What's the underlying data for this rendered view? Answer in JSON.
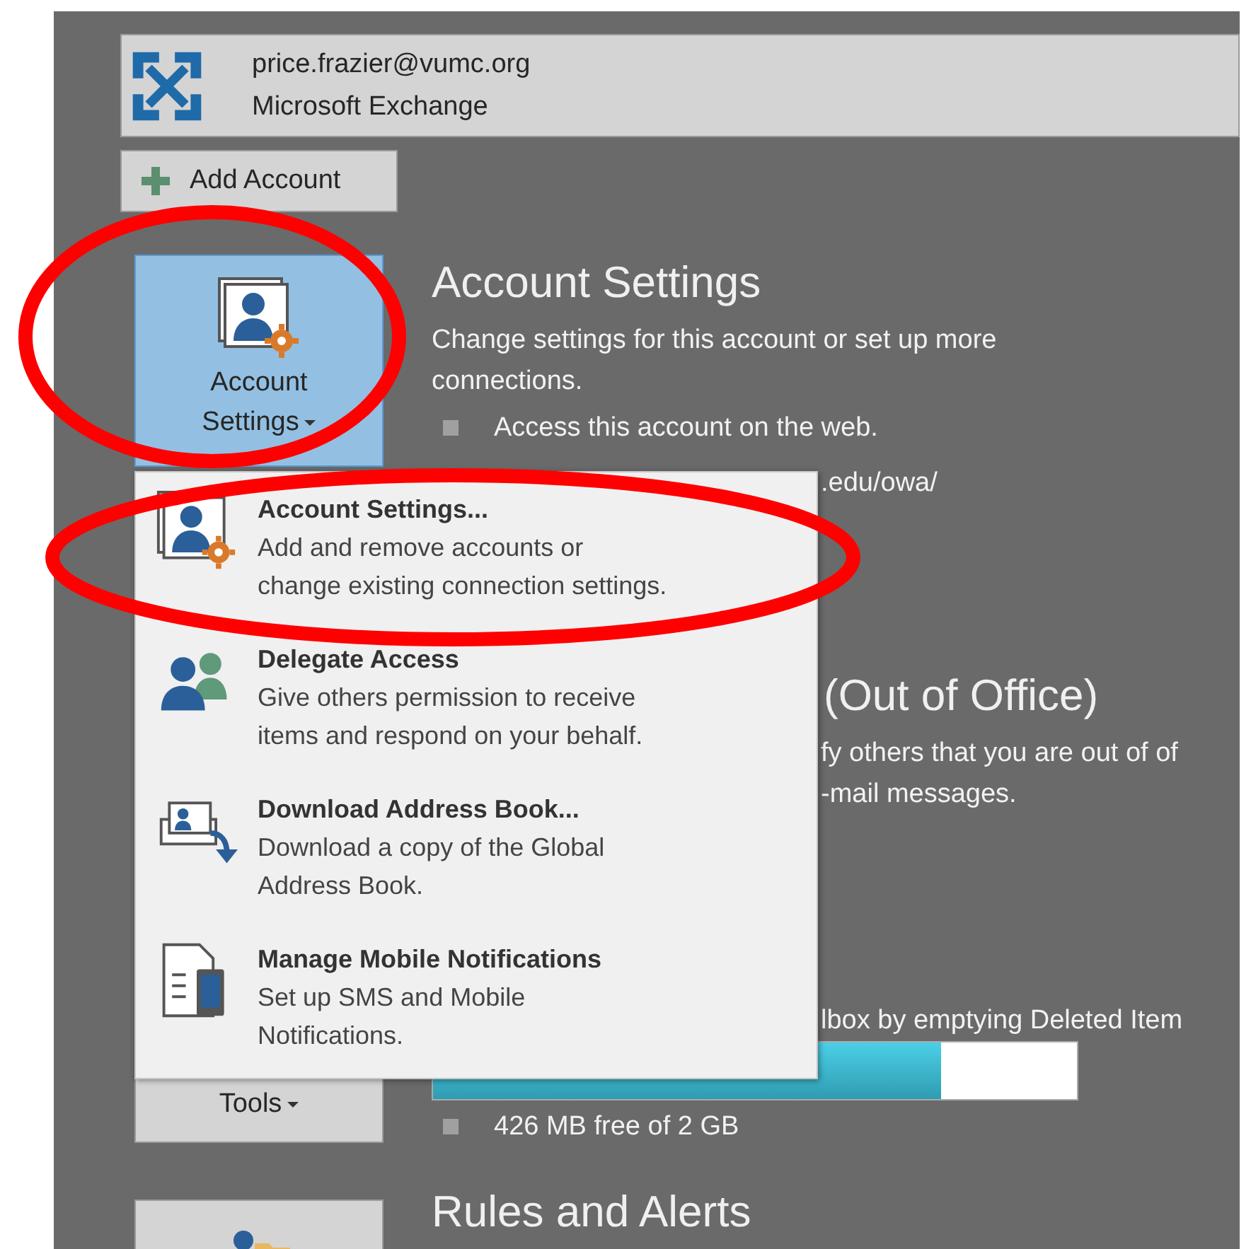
{
  "account": {
    "email": "price.frazier@vumc.org",
    "type": "Microsoft Exchange"
  },
  "add_account": {
    "label": "Add Account"
  },
  "account_settings_button": {
    "label": "Account Settings",
    "selected": true
  },
  "account_settings_section": {
    "heading": "Account Settings",
    "description": "Change settings for this account or set up more connections.",
    "bullet": "Access this account on the web.",
    "url_partial": ".edu/owa/"
  },
  "automatic_replies_section": {
    "heading_partial": "(Out of Office)",
    "lines": [
      "fy others that you are out of of",
      "-mail messages."
    ]
  },
  "mailbox_section": {
    "description_partial": "lbox by emptying Deleted Item",
    "storage": {
      "level": 0.79
    },
    "free_space": "426 MB free of 2 GB"
  },
  "tools_button": {
    "label": "Tools"
  },
  "rules_section": {
    "heading": "Rules and Alerts"
  },
  "dropdown_menu": {
    "items": [
      {
        "kind": "settings",
        "title": "Account Settings...",
        "description": "Add and remove accounts or change existing connection settings."
      },
      {
        "kind": "delegate",
        "title": "Delegate Access",
        "description": "Give others permission to receive items and respond on your behalf."
      },
      {
        "kind": "address-book",
        "title": "Download Address Book...",
        "description": "Download a copy of the Global Address Book."
      },
      {
        "kind": "mobile",
        "title": "Manage Mobile Notifications",
        "description": "Set up SMS and Mobile Notifications."
      }
    ]
  },
  "annotations": [
    {
      "kind": "ellipse"
    },
    {
      "kind": "ellipse"
    }
  ]
}
